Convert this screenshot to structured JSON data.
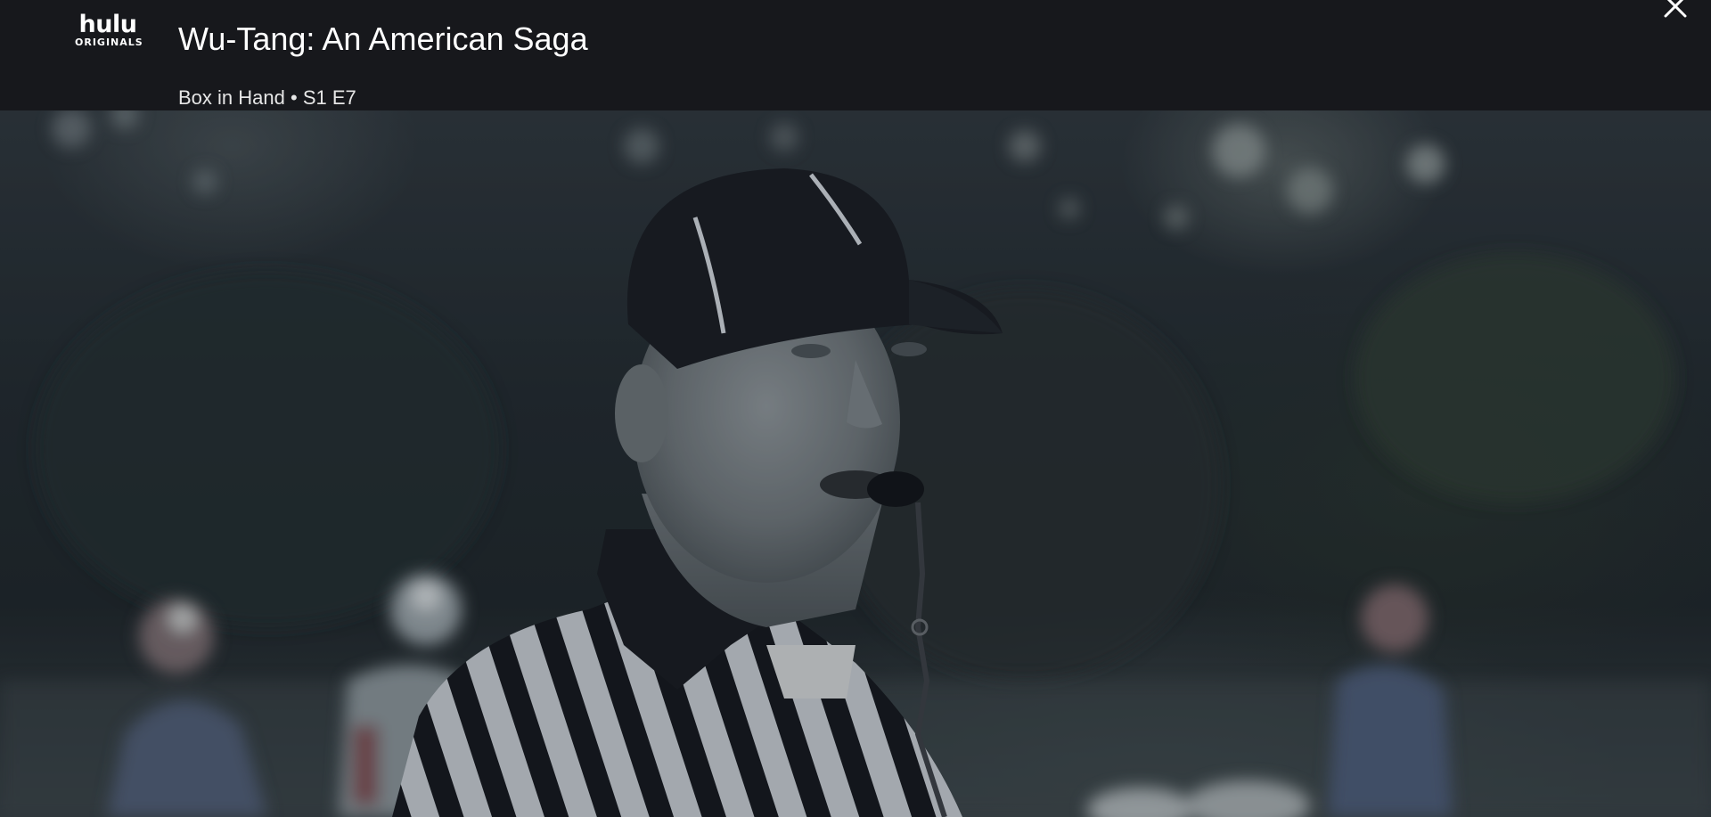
{
  "brand": {
    "name": "hulu",
    "tagline": "ORIGINALS"
  },
  "player": {
    "show_title": "Wu-Tang: An American Saga",
    "episode_title": "Box in Hand",
    "episode_code": "S1 E7",
    "separator": "•"
  },
  "icons": {
    "close": "close-icon"
  },
  "colors": {
    "top_bar": "#17181c",
    "text": "#ffffff"
  }
}
